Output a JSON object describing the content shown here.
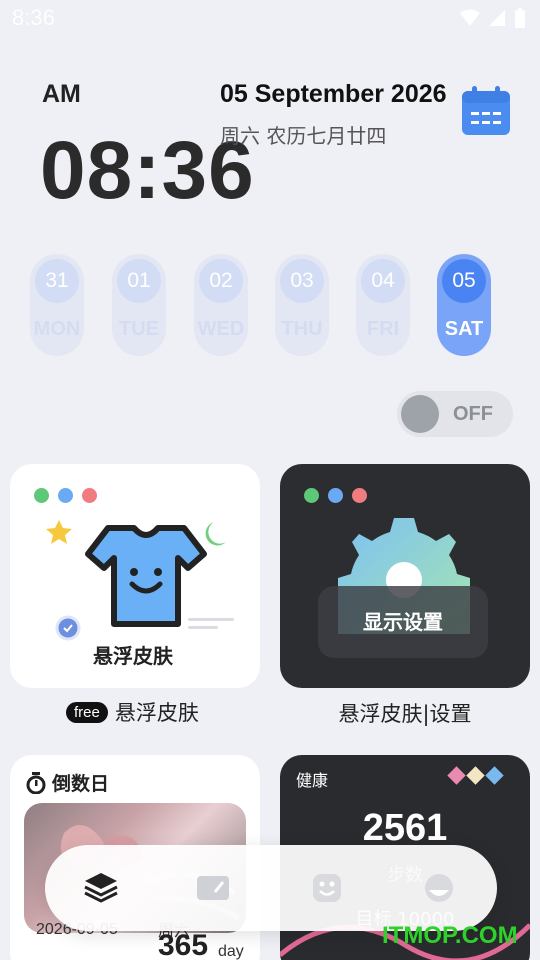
{
  "status_bar": {
    "time": "8:36",
    "icons": [
      "wifi-icon",
      "signal-icon",
      "battery-icon"
    ]
  },
  "clock": {
    "ampm": "AM",
    "time": "08:36"
  },
  "date": {
    "full": "05 September 2026",
    "lunar": "周六  农历七月廿四"
  },
  "week": [
    {
      "num": "31",
      "name": "MON",
      "active": false
    },
    {
      "num": "01",
      "name": "TUE",
      "active": false
    },
    {
      "num": "02",
      "name": "WED",
      "active": false
    },
    {
      "num": "03",
      "name": "THU",
      "active": false
    },
    {
      "num": "04",
      "name": "FRI",
      "active": false
    },
    {
      "num": "05",
      "name": "SAT",
      "active": true
    }
  ],
  "toggle": {
    "label": "OFF",
    "on": false
  },
  "cards": {
    "skin": {
      "caption_in_card": "悬浮皮肤",
      "badge": "free",
      "caption": "悬浮皮肤"
    },
    "settings": {
      "button": "显示设置",
      "caption": "悬浮皮肤|设置"
    },
    "countdown": {
      "title": "倒数日",
      "date": "2026-09-05",
      "weekday": "周六",
      "days": "365",
      "unit": "day"
    },
    "health": {
      "title": "健康",
      "steps": "2561",
      "steps_label": "步数",
      "goal": "目标 10000"
    }
  },
  "colors": {
    "accent": "#4a84f3",
    "dot_green": "#5cc878",
    "dot_blue": "#6aaaf5",
    "dot_red": "#f07c80",
    "watermark": "#2ed02a"
  },
  "bottom_nav": [
    "layers-icon",
    "card-icon",
    "smile-icon",
    "face-icon"
  ],
  "watermark": "ITMOP.COM"
}
